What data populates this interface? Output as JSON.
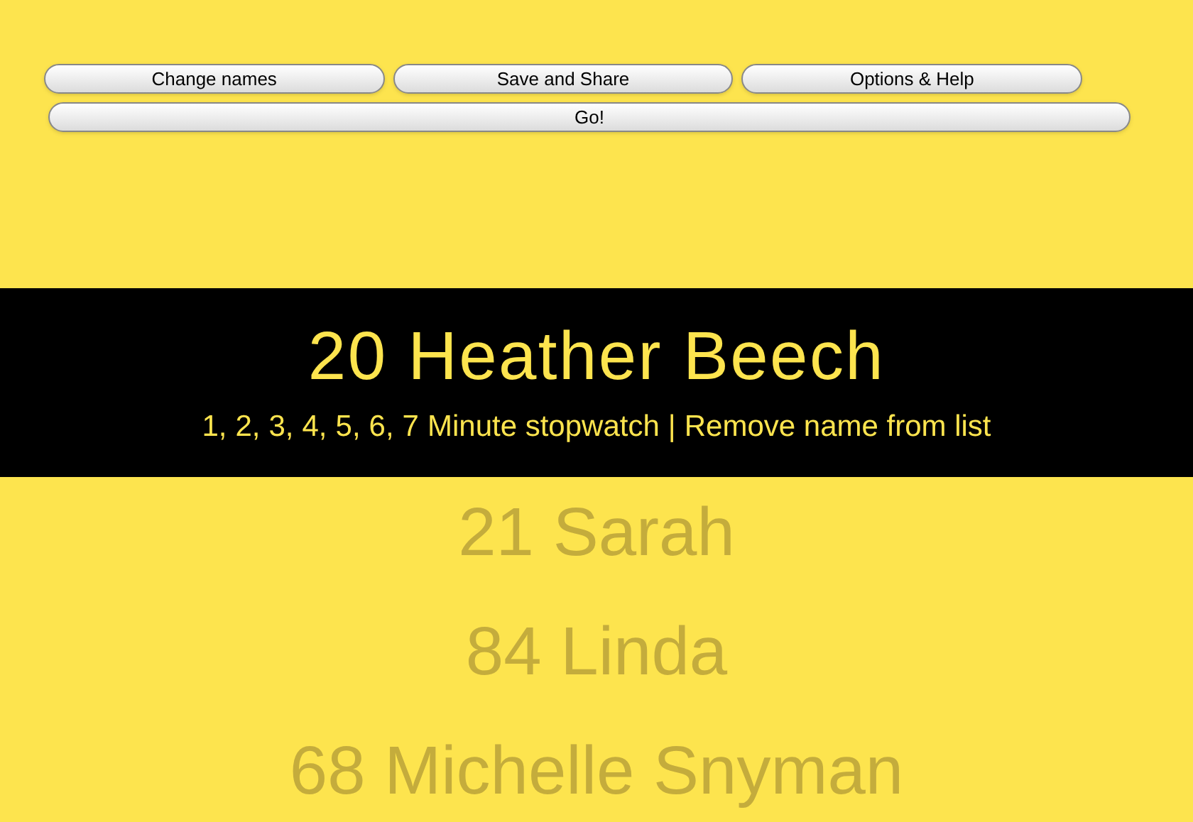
{
  "buttons": [
    "Change names",
    "Save and Share",
    "Options & Help"
  ],
  "go_button": "Go!",
  "current": {
    "name": "20 Heather Beech",
    "minutes": [
      "1,",
      "2,",
      "3,",
      "4,",
      "5,",
      "6,",
      "7"
    ],
    "stopwatch_label": "Minute stopwatch",
    "separator": "|",
    "remove_link": "Remove name from list"
  },
  "queue": [
    "21 Sarah",
    "84 Linda",
    "68 Michelle Snyman"
  ]
}
